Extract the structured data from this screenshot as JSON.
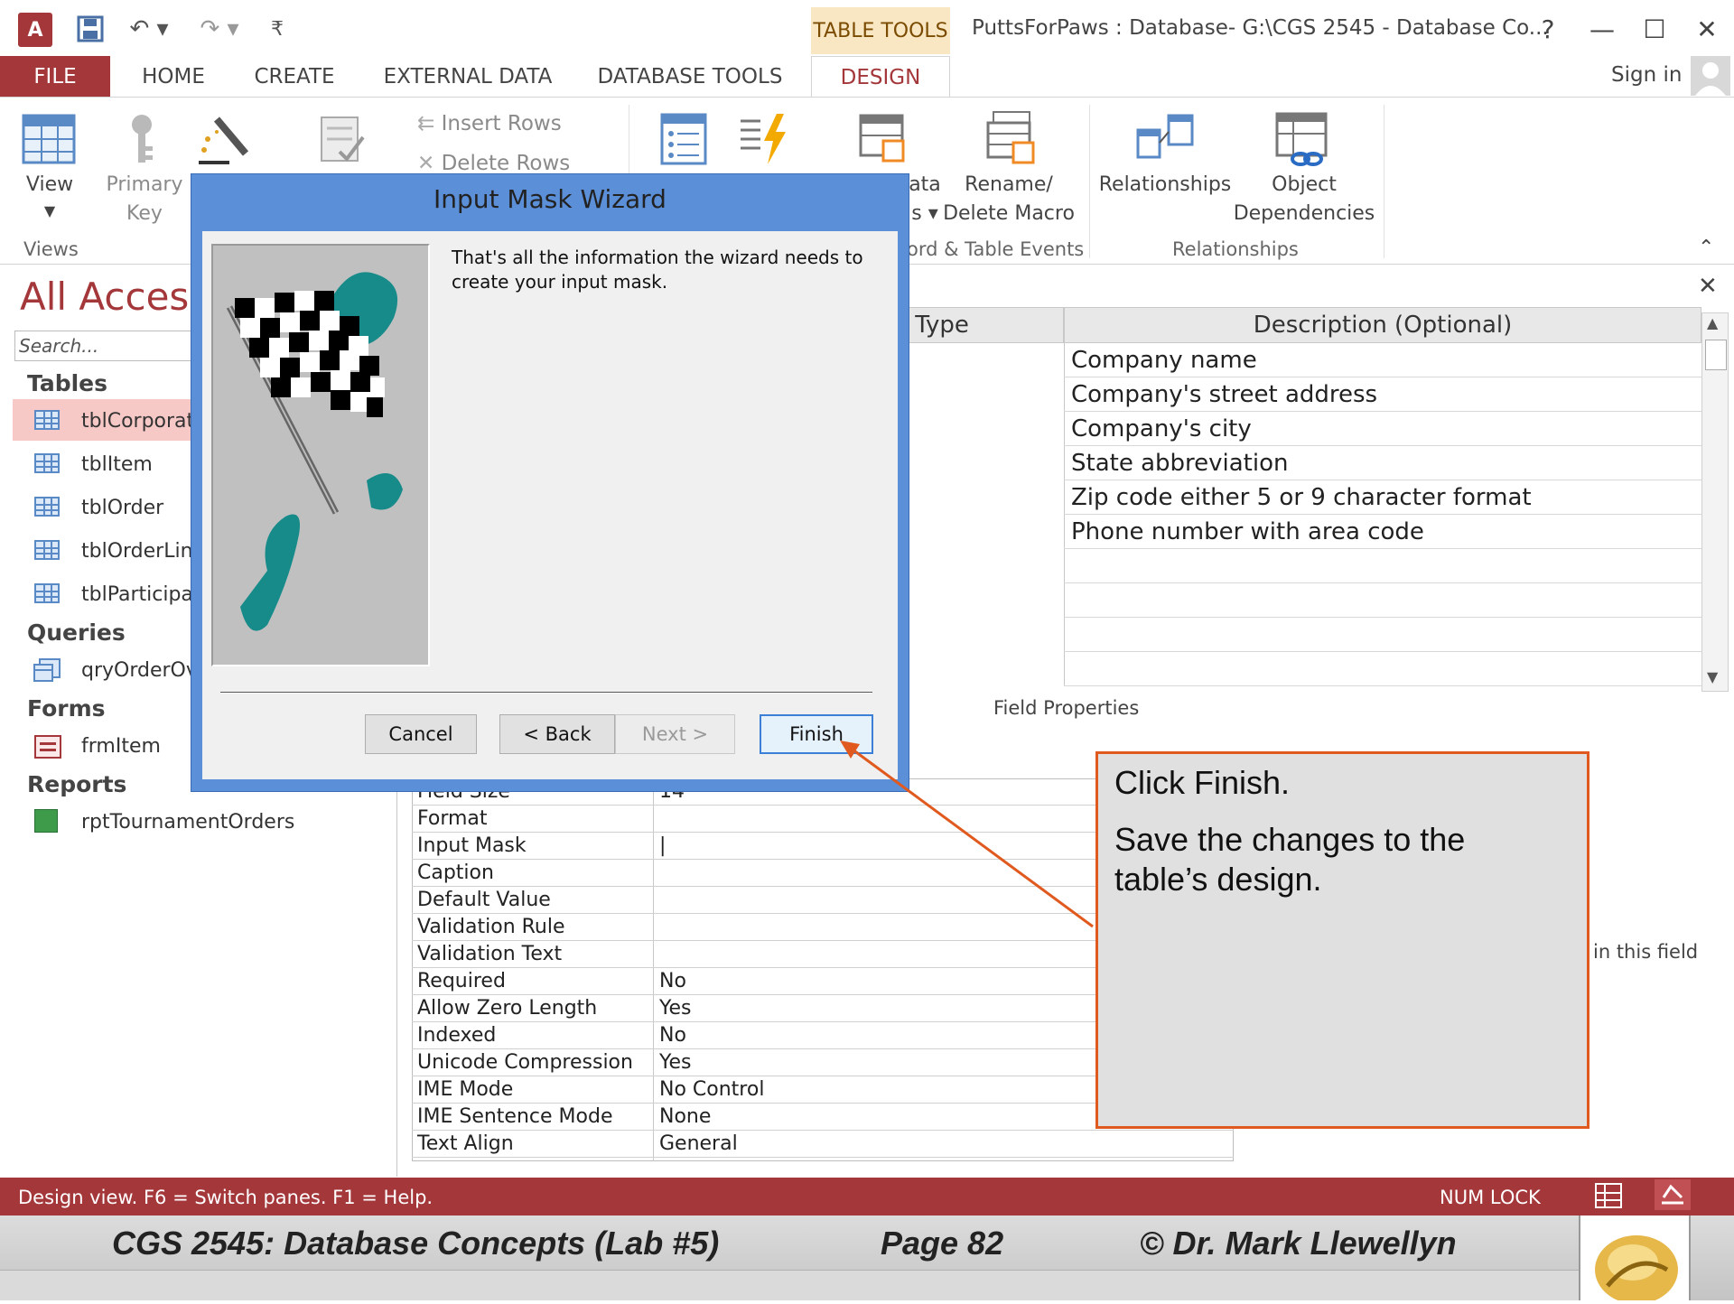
{
  "title_bar": {
    "app_icon": "access-icon",
    "table_tools": "TABLE TOOLS",
    "window_title": "PuttsForPaws : Database- G:\\CGS 2545 - Database Co...",
    "help": "?",
    "minimize": "—",
    "restore": "☐",
    "close": "✕"
  },
  "ribbon_tabs": [
    "FILE",
    "HOME",
    "CREATE",
    "EXTERNAL DATA",
    "DATABASE TOOLS",
    "DESIGN"
  ],
  "sign_in": "Sign in",
  "ribbon": {
    "view": "View",
    "primary_key_1": "Primary",
    "primary_key_2": "Key",
    "insert_rows": "Insert Rows",
    "delete_rows": "Delete Rows",
    "data_frag": "ata",
    "macro_frag": "s ▾",
    "rename_1": "Rename/",
    "rename_2": "Delete Macro",
    "relationships": "Relationships",
    "object_1": "Object",
    "object_2": "Dependencies",
    "group_views": "Views",
    "group_events": "ord & Table Events",
    "group_relationships": "Relationships"
  },
  "nav": {
    "title": "All Access",
    "search_placeholder": "Search...",
    "tables_hdr": "Tables",
    "tables": [
      "tblCorporat",
      "tblItem",
      "tblOrder",
      "tblOrderLin",
      "tblParticipa"
    ],
    "queries_hdr": "Queries",
    "queries": [
      "qryOrderOv"
    ],
    "forms_hdr": "Forms",
    "forms": [
      "frmItem"
    ],
    "reports_hdr": "Reports",
    "reports": [
      "rptTournamentOrders"
    ]
  },
  "design_grid": {
    "col_type": "a Type",
    "col_desc": "Description (Optional)",
    "descriptions": [
      "Company name",
      "Company's street address",
      "Company's city",
      "State abbreviation",
      "Zip code either 5 or 9 character format",
      "Phone number with area code",
      "",
      "",
      "",
      ""
    ],
    "field_properties": "Field Properties"
  },
  "properties": [
    {
      "label": "Field Size",
      "value": "14"
    },
    {
      "label": "Format",
      "value": ""
    },
    {
      "label": "Input Mask",
      "value": "|"
    },
    {
      "label": "Caption",
      "value": ""
    },
    {
      "label": "Default Value",
      "value": ""
    },
    {
      "label": "Validation Rule",
      "value": ""
    },
    {
      "label": "Validation Text",
      "value": ""
    },
    {
      "label": "Required",
      "value": "No"
    },
    {
      "label": "Allow Zero Length",
      "value": "Yes"
    },
    {
      "label": "Indexed",
      "value": "No"
    },
    {
      "label": "Unicode Compression",
      "value": "Yes"
    },
    {
      "label": "IME Mode",
      "value": "No Control"
    },
    {
      "label": "IME Sentence Mode",
      "value": "None"
    },
    {
      "label": "Text Align",
      "value": "General"
    }
  ],
  "help_fragment": "in this field",
  "wizard": {
    "title": "Input Mask Wizard",
    "message": "That's all the information the wizard needs to create your input mask.",
    "cancel": "Cancel",
    "back": "< Back",
    "next": "Next >",
    "finish": "Finish"
  },
  "callout": {
    "line1": "Click Finish.",
    "line2": "Save the changes to the table’s design."
  },
  "status": {
    "left": "Design view.  F6 = Switch panes.  F1 = Help.",
    "num_lock": "NUM LOCK"
  },
  "footer": {
    "course": "CGS 2545: Database Concepts  (Lab #5)",
    "page": "Page 82",
    "author": "© Dr. Mark Llewellyn"
  },
  "colors": {
    "accent": "#a4373a",
    "dialog": "#5b8fd8",
    "callout_border": "#e05a1f"
  }
}
